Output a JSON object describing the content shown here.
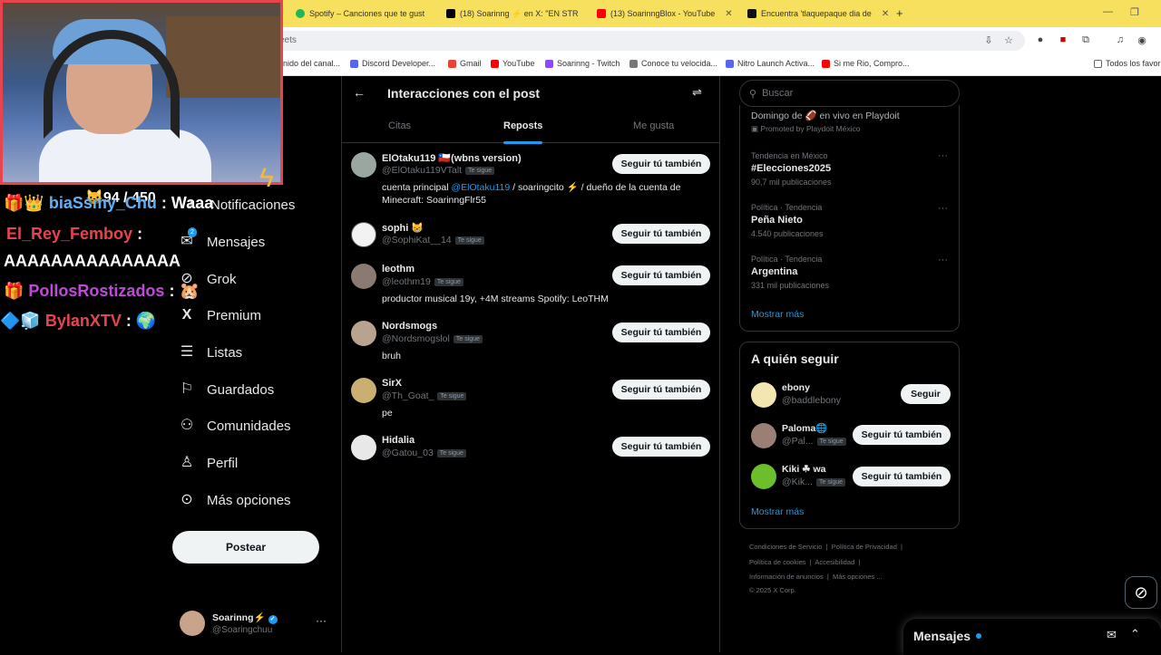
{
  "browser": {
    "tabs": [
      {
        "title": "Spotify – Canciones que te gust",
        "color": "#1db954"
      },
      {
        "title": "(18) Soarinng ⚡ en X: \"EN STR",
        "color": "#000000"
      },
      {
        "title": "(13) SoarinngBlox - YouTube",
        "color": "#ff0000"
      },
      {
        "title": "Encuentra 'tlaquepaque dia de",
        "color": "#111111"
      }
    ],
    "address": "eets",
    "bookmarks": [
      {
        "label": "nido del canal...",
        "color": "#888888"
      },
      {
        "label": "Discord Developer...",
        "color": "#5865f2"
      },
      {
        "label": "Gmail",
        "color": "#ea4335"
      },
      {
        "label": "YouTube",
        "color": "#ff0000"
      },
      {
        "label": "Soarinng - Twitch",
        "color": "#9146ff"
      },
      {
        "label": "Conoce tu velocida...",
        "color": "#777777"
      },
      {
        "label": "Nitro Launch Activa...",
        "color": "#5865f2"
      },
      {
        "label": "Si me Rio, Compro...",
        "color": "#ff0000"
      },
      {
        "label": "Todos los favori",
        "color": "#666666"
      }
    ]
  },
  "overlay": {
    "followers": "94 / 450",
    "chat": [
      {
        "name": "biaSsmy_Chu",
        "msg": "Waaa",
        "color": "#62b0f5"
      },
      {
        "name": "El_Rey_Femboy",
        "msg": ":",
        "color": "#e8444f"
      },
      {
        "name": "",
        "msg": "AAAAAAAAAAAAAAA",
        "color": "#ffffff"
      },
      {
        "name": "PollosRostizados",
        "msg": ":",
        "color": "#c04ad8"
      },
      {
        "name": "BylanXTV",
        "msg": ":",
        "color": "#e8444f"
      }
    ]
  },
  "nav": {
    "items": [
      {
        "label": "Notificaciones",
        "icon": "bell-icon",
        "glyph": "♪"
      },
      {
        "label": "Mensajes",
        "icon": "mail-icon",
        "glyph": "✉"
      },
      {
        "label": "Grok",
        "icon": "grok-icon",
        "glyph": "⊘"
      },
      {
        "label": "Premium",
        "icon": "x-logo-icon",
        "glyph": "𝕏"
      },
      {
        "label": "Listas",
        "icon": "list-icon",
        "glyph": "☰"
      },
      {
        "label": "Guardados",
        "icon": "bookmark-icon",
        "glyph": "⚑"
      },
      {
        "label": "Comunidades",
        "icon": "communities-icon",
        "glyph": "⚇"
      },
      {
        "label": "Perfil",
        "icon": "person-icon",
        "glyph": "☺"
      },
      {
        "label": "Más opciones",
        "icon": "more-circle-icon",
        "glyph": "⋯"
      }
    ],
    "messages_badge": "2",
    "post_button": "Postear",
    "account": {
      "name": "Soarinng⚡",
      "handle": "@Soaringchuu"
    }
  },
  "main": {
    "title": "Interacciones con el post",
    "tabs": [
      "Citas",
      "Reposts",
      "Me gusta"
    ],
    "active_tab": "Reposts",
    "follow_label": "Seguir tú también",
    "follows_you": "Te sigue",
    "users": [
      {
        "name": "ElOtaku119 🇨🇱(wbns version)",
        "handle": "@ElOtaku119VTalt",
        "bio_pre": "cuenta principal ",
        "bio_mention": "@ElOtaku119",
        "bio_post": " / soaringcito ⚡ / dueño de la cuenta de Minecraft: SoarinngFlr55",
        "avatar": "#9aa6a0"
      },
      {
        "name": "sophi 😸",
        "handle": "@SophiKat__14",
        "bio_pre": "",
        "bio_mention": "",
        "bio_post": "",
        "avatar": "#f2f2f2"
      },
      {
        "name": "leothm",
        "handle": "@leothm19",
        "bio_pre": "productor musical 19y, +4M streams Spotify: LeoTHM",
        "bio_mention": "",
        "bio_post": "",
        "avatar": "#8a7a72"
      },
      {
        "name": "Nordsmogs",
        "handle": "@Nordsmogslol",
        "bio_pre": "bruh",
        "bio_mention": "",
        "bio_post": "",
        "avatar": "#b9a38f"
      },
      {
        "name": "SirX",
        "handle": "@Th_Goat_",
        "bio_pre": "pe",
        "bio_mention": "",
        "bio_post": "",
        "avatar": "#c9b070"
      },
      {
        "name": "Hidalia",
        "handle": "@Gatou_03",
        "bio_pre": "",
        "bio_mention": "",
        "bio_post": "",
        "avatar": "#e8e8e8"
      }
    ]
  },
  "right": {
    "search_placeholder": "Buscar",
    "promo": {
      "title": "Domingo de 🏈 en vivo en Playdoit",
      "sub": "Promoted by Playdoit México"
    },
    "trends": [
      {
        "meta": "Tendencia en México",
        "name": "#Elecciones2025",
        "count": "90,7 mil publicaciones"
      },
      {
        "meta": "Política · Tendencia",
        "name": "Peña Nieto",
        "count": "4.540 publicaciones"
      },
      {
        "meta": "Política · Tendencia",
        "name": "Argentina",
        "count": "331 mil publicaciones"
      }
    ],
    "show_more": "Mostrar más",
    "who_to_follow": "A quién seguir",
    "suggestions": [
      {
        "name": "ebony",
        "handle": "@baddlebony",
        "button": "Seguir",
        "follows_you": "",
        "avatar": "#f4e6b0"
      },
      {
        "name": "Paloma🌐",
        "handle": "@Pal...",
        "button": "Seguir tú también",
        "follows_you": "Te sigue",
        "avatar": "#9a7f74"
      },
      {
        "name": "Kiki ☘ wa",
        "handle": "@Kik...",
        "button": "Seguir tú también",
        "follows_you": "Te sigue",
        "avatar": "#6bbf2a"
      }
    ],
    "footer": {
      "line1": [
        "Condiciones de Servicio",
        "Política de Privacidad"
      ],
      "line2": [
        "Política de cookies",
        "Accesibilidad"
      ],
      "line3": [
        "Información de anuncios",
        "Más opciones ..."
      ],
      "copyright": "© 2025 X Corp."
    },
    "messages_drawer": "Mensajes"
  }
}
